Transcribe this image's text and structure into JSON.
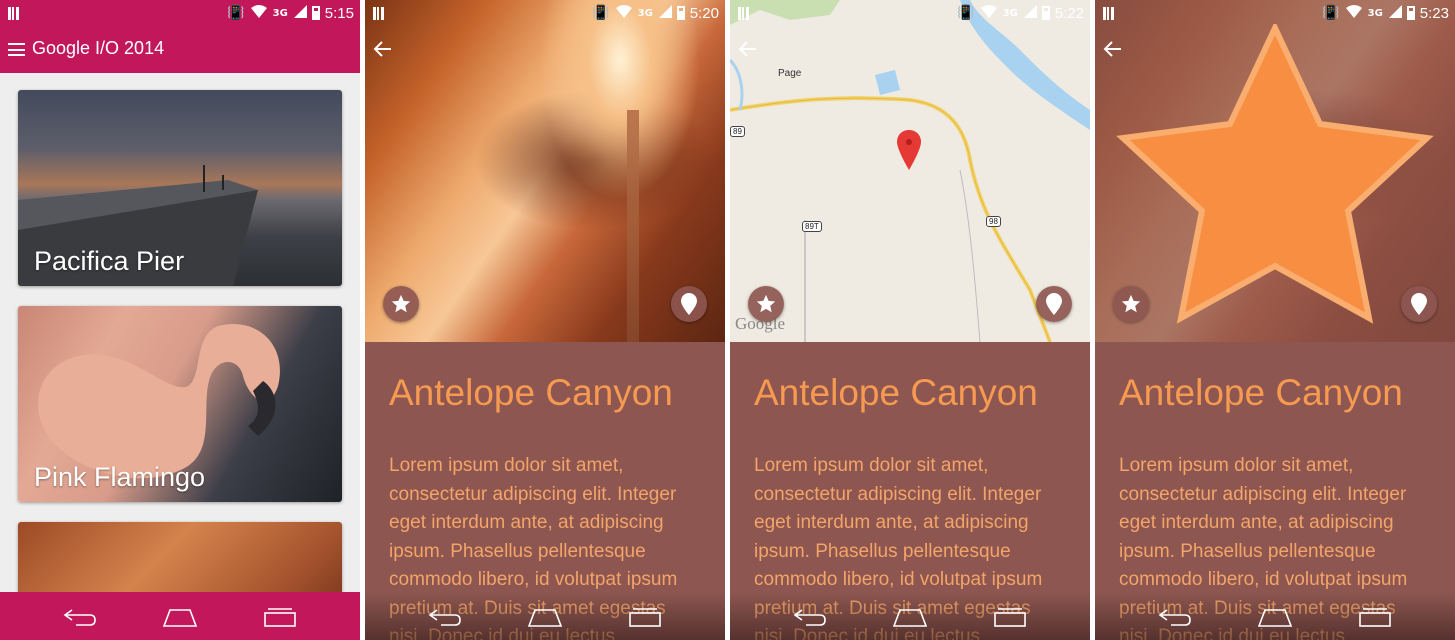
{
  "screens": [
    {
      "status": {
        "time": "5:15",
        "network": "3G"
      },
      "app_bar": {
        "title": "Google I/O 2014"
      },
      "cards": [
        {
          "label": "Pacifica Pier"
        },
        {
          "label": "Pink Flamingo"
        },
        {
          "label": ""
        }
      ]
    },
    {
      "status": {
        "time": "5:20",
        "network": "3G"
      },
      "detail": {
        "title": "Antelope Canyon",
        "body": "Lorem ipsum dolor sit amet, consectetur adipiscing elit. Integer eget interdum ante, at adipiscing ipsum. Phasellus pellentesque commodo libero, id volutpat ipsum pretium at. Duis sit amet egestas nisi. Donec id dui eu lectus"
      }
    },
    {
      "status": {
        "time": "5:22",
        "network": "3G"
      },
      "map": {
        "place_label": "Page",
        "route_1": "98",
        "route_2": "89T",
        "route_3": "89",
        "provider": "Google"
      },
      "detail": {
        "title": "Antelope Canyon",
        "body": "Lorem ipsum dolor sit amet, consectetur adipiscing elit. Integer eget interdum ante, at adipiscing ipsum. Phasellus pellentesque commodo libero, id volutpat ipsum pretium at. Duis sit amet egestas nisi. Donec id dui eu lectus"
      }
    },
    {
      "status": {
        "time": "5:23",
        "network": "3G"
      },
      "detail": {
        "title": "Antelope Canyon",
        "body": "Lorem ipsum dolor sit amet, consectetur adipiscing elit. Integer eget interdum ante, at adipiscing ipsum. Phasellus pellentesque commodo libero, id volutpat ipsum pretium at. Duis sit amet egestas nisi. Donec id dui eu lectus"
      }
    }
  ],
  "colors": {
    "app_bar": "#c2185b",
    "detail_bg": "#8d5650",
    "title_text": "#f69a52",
    "body_text": "#f3a469",
    "star": "#f58b3c"
  },
  "icons": [
    "menu-icon",
    "back-arrow-icon",
    "star-icon",
    "location-pin-icon",
    "back-nav-icon",
    "home-nav-icon",
    "recents-nav-icon",
    "wifi-icon",
    "signal-icon",
    "battery-icon",
    "vibrate-icon",
    "sim-icon",
    "map-marker-icon"
  ]
}
